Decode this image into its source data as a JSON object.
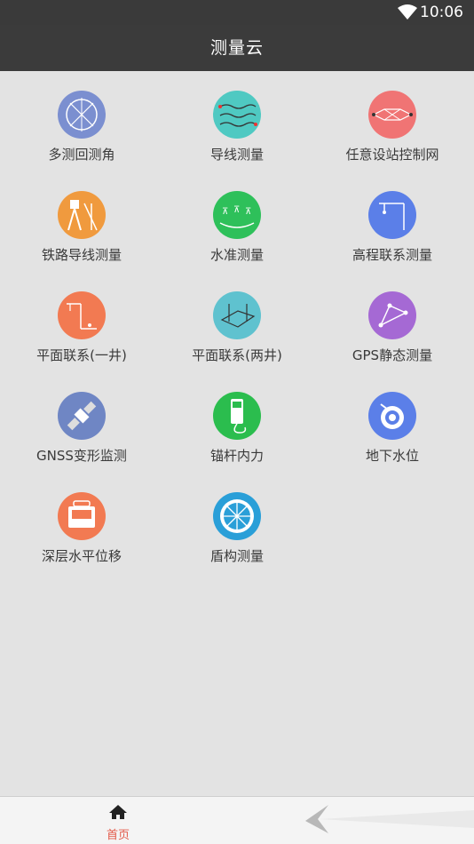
{
  "status_bar": {
    "time": "10:06"
  },
  "app_bar": {
    "title": "测量云"
  },
  "tiles": [
    {
      "label": "多测回测角",
      "icon": "theodolite-angle-icon",
      "color": "#7b8fd0"
    },
    {
      "label": "导线测量",
      "icon": "traverse-icon",
      "color": "#4fc9c2"
    },
    {
      "label": "任意设站控制网",
      "icon": "control-network-icon",
      "color": "#f07474"
    },
    {
      "label": "铁路导线测量",
      "icon": "railway-traverse-icon",
      "color": "#f09a3e"
    },
    {
      "label": "水准测量",
      "icon": "leveling-icon",
      "color": "#2ec05a"
    },
    {
      "label": "高程联系测量",
      "icon": "elevation-link-icon",
      "color": "#5b7fe8"
    },
    {
      "label": "平面联系(一井)",
      "icon": "plane-link-single-shaft-icon",
      "color": "#f27a52"
    },
    {
      "label": "平面联系(两井)",
      "icon": "plane-link-double-shaft-icon",
      "color": "#5fc2cf"
    },
    {
      "label": "GPS静态测量",
      "icon": "gps-static-icon",
      "color": "#a569d4"
    },
    {
      "label": "GNSS变形监测",
      "icon": "satellite-icon",
      "color": "#6f86c4"
    },
    {
      "label": "锚杆内力",
      "icon": "anchor-force-meter-icon",
      "color": "#2bbd4e"
    },
    {
      "label": "地下水位",
      "icon": "groundwater-gauge-icon",
      "color": "#5b7fe8"
    },
    {
      "label": "深层水平位移",
      "icon": "inclinometer-icon",
      "color": "#f27a52"
    },
    {
      "label": "盾构测量",
      "icon": "shield-tunnel-icon",
      "color": "#2a9fd8"
    }
  ],
  "bottom_nav": {
    "home_label": "首页",
    "active_color": "#e35a4a"
  }
}
